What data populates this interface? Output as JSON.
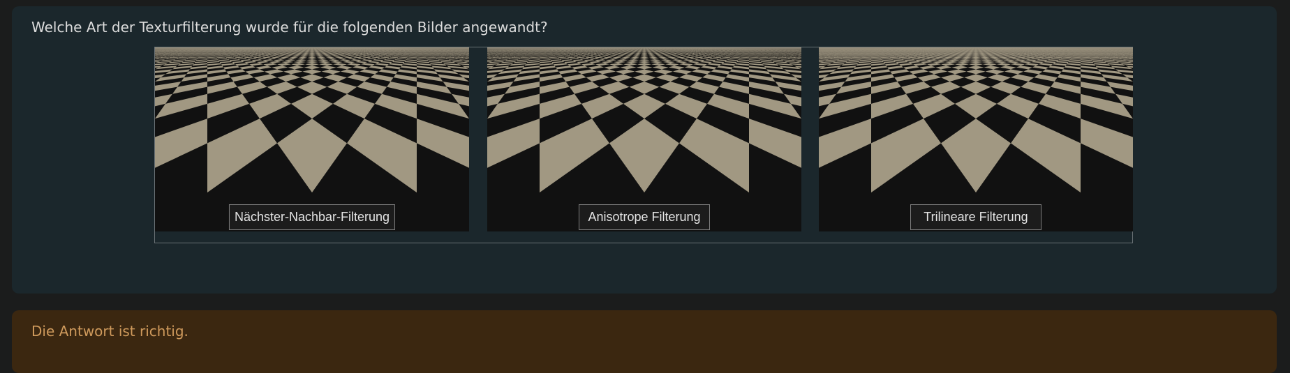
{
  "question": {
    "text": "Welche Art der Texturfilterung wurde für die folgenden Bilder angewandt?"
  },
  "images": [
    {
      "label": "Nächster-Nachbar-Filterung",
      "filter": "nearest"
    },
    {
      "label": "Anisotrope Filterung",
      "filter": "anisotropic"
    },
    {
      "label": "Trilineare Filterung",
      "filter": "trilinear"
    }
  ],
  "feedback": {
    "text": "Die Antwort ist richtig."
  },
  "colors": {
    "page_background": "#1b1c1c",
    "question_panel": "#1b272c",
    "answer_panel": "#3b2710",
    "answer_text": "#cf9a5c",
    "tile_light": "#a19882",
    "tile_dark": "#111111",
    "horizon": "#9c937f"
  }
}
